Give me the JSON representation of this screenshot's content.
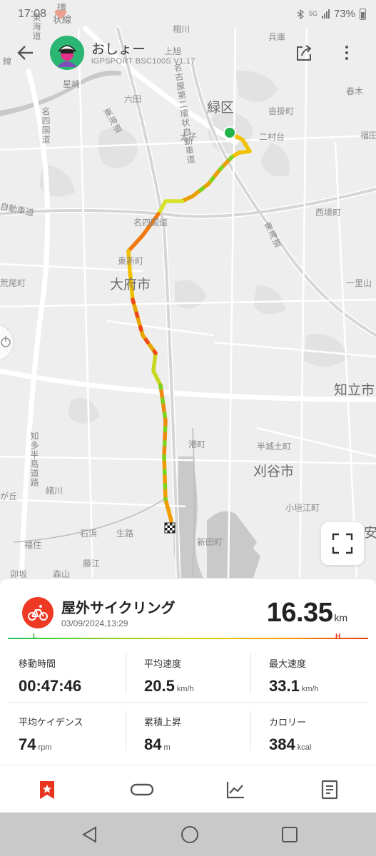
{
  "status_bar": {
    "time": "17:08",
    "battery": "73%",
    "network": "5G"
  },
  "header": {
    "user_name": "おしょー",
    "device": "iGPSPORT BSC100S  V1.17"
  },
  "map": {
    "labels": [
      {
        "text": "環",
        "cls": "md"
      },
      {
        "text": "状線",
        "cls": "md"
      },
      {
        "text": "東海道",
        "cls": "v"
      },
      {
        "text": "相川",
        "cls": "sm"
      },
      {
        "text": "兵庫",
        "cls": "sm"
      },
      {
        "text": "上旭",
        "cls": "sm"
      },
      {
        "text": "線",
        "cls": "sm"
      },
      {
        "text": "星崎",
        "cls": "sm"
      },
      {
        "text": "六田",
        "cls": "sm"
      },
      {
        "text": "名古屋第二環状自動車道",
        "cls": "v"
      },
      {
        "text": "緑区",
        "cls": "lg"
      },
      {
        "text": "沓掛町",
        "cls": "sm"
      },
      {
        "text": "春木",
        "cls": "sm"
      },
      {
        "text": "名四国道",
        "cls": "v"
      },
      {
        "text": "東海道",
        "cls": "v"
      },
      {
        "text": "太子",
        "cls": "sm"
      },
      {
        "text": "二村台",
        "cls": "sm"
      },
      {
        "text": "福田",
        "cls": "sm"
      },
      {
        "text": "自動車道",
        "cls": "sm"
      },
      {
        "text": "名四国道",
        "cls": "sm"
      },
      {
        "text": "西境町",
        "cls": "sm"
      },
      {
        "text": "東海道",
        "cls": "v"
      },
      {
        "text": "東新町",
        "cls": "sm"
      },
      {
        "text": "荒尾町",
        "cls": "sm"
      },
      {
        "text": "大府市",
        "cls": "lg"
      },
      {
        "text": "一里山",
        "cls": "sm"
      },
      {
        "text": "市",
        "cls": "sm"
      },
      {
        "text": "知立市",
        "cls": "lg"
      },
      {
        "text": "知多半島道路",
        "cls": "v"
      },
      {
        "text": "港町",
        "cls": "sm"
      },
      {
        "text": "半城土町",
        "cls": "sm"
      },
      {
        "text": "刈谷市",
        "cls": "lg"
      },
      {
        "text": "が丘",
        "cls": "sm"
      },
      {
        "text": "緒川",
        "cls": "sm"
      },
      {
        "text": "小垣江町",
        "cls": "sm"
      },
      {
        "text": "石浜",
        "cls": "sm"
      },
      {
        "text": "生路",
        "cls": "sm"
      },
      {
        "text": "安",
        "cls": "lg"
      },
      {
        "text": "福住",
        "cls": "sm"
      },
      {
        "text": "新田町",
        "cls": "sm"
      },
      {
        "text": "藤江",
        "cls": "sm"
      },
      {
        "text": "卯坂",
        "cls": "sm"
      },
      {
        "text": "森山",
        "cls": "sm"
      }
    ]
  },
  "activity": {
    "type": "屋外サイクリング",
    "date": "03/09/2024,13:29",
    "distance": "16.35",
    "distance_unit": "km",
    "gradient_low": "L",
    "gradient_high": "H"
  },
  "stats": [
    {
      "label": "移動時間",
      "value": "00:47:46",
      "unit": ""
    },
    {
      "label": "平均速度",
      "value": "20.5",
      "unit": "km/h"
    },
    {
      "label": "最大速度",
      "value": "33.1",
      "unit": "km/h"
    },
    {
      "label": "平均ケイデンス",
      "value": "74",
      "unit": "rpm"
    },
    {
      "label": "累積上昇",
      "value": "84",
      "unit": "m"
    },
    {
      "label": "カロリー",
      "value": "384",
      "unit": "kcal"
    }
  ],
  "tabs": [
    {
      "icon": "bookmark-star-icon",
      "active": true
    },
    {
      "icon": "loop-icon",
      "active": false
    },
    {
      "icon": "chart-icon",
      "active": false
    },
    {
      "icon": "document-icon",
      "active": false
    }
  ],
  "colors": {
    "accent": "#ee3a24",
    "start": "#22b24c",
    "low": "#22c55e",
    "high": "#e8351f"
  }
}
